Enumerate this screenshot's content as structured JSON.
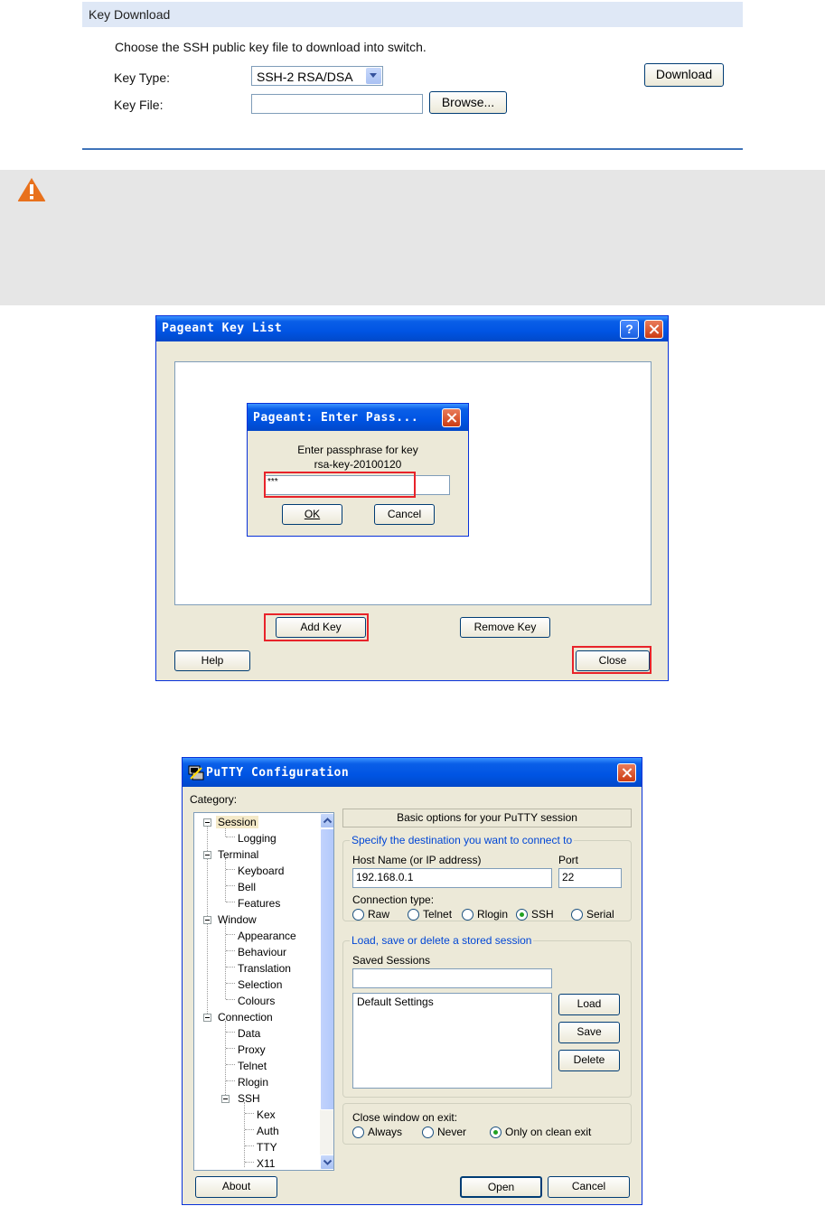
{
  "key_download": {
    "header": "Key Download",
    "instruction": "Choose the SSH public key file to download into switch.",
    "key_type_label": "Key Type:",
    "key_type_value": "SSH-2 RSA/DSA",
    "key_file_label": "Key File:",
    "key_file_value": "",
    "browse_label": "Browse...",
    "download_label": "Download"
  },
  "pageant": {
    "title": "Pageant Key List",
    "add_key_label": "Add Key",
    "remove_key_label": "Remove Key",
    "help_label": "Help",
    "close_label": "Close",
    "dialog": {
      "title": "Pageant: Enter Pass...",
      "prompt_line1": "Enter passphrase for key",
      "prompt_line2": "rsa-key-20100120",
      "passphrase_value": "***",
      "ok_label": "OK",
      "cancel_label": "Cancel"
    }
  },
  "putty": {
    "title": "PuTTY Configuration",
    "category_label": "Category:",
    "tree": [
      "Session",
      "Logging",
      "Terminal",
      "Keyboard",
      "Bell",
      "Features",
      "Window",
      "Appearance",
      "Behaviour",
      "Translation",
      "Selection",
      "Colours",
      "Connection",
      "Data",
      "Proxy",
      "Telnet",
      "Rlogin",
      "SSH",
      "Kex",
      "Auth",
      "TTY",
      "X11"
    ],
    "banner": "Basic options for your PuTTY session",
    "dest_group": "Specify the destination you want to connect to",
    "host_label": "Host Name (or IP address)",
    "host_value": "192.168.0.1",
    "port_label": "Port",
    "port_value": "22",
    "conn_type_label": "Connection type:",
    "conn_types": [
      "Raw",
      "Telnet",
      "Rlogin",
      "SSH",
      "Serial"
    ],
    "selected_conn_type": "SSH",
    "sessions_group": "Load, save or delete a stored session",
    "saved_sessions_label": "Saved Sessions",
    "saved_sessions_value": "",
    "sessions_list": [
      "Default Settings"
    ],
    "load_label": "Load",
    "save_label": "Save",
    "delete_label": "Delete",
    "close_exit_label": "Close window on exit:",
    "exit_options": [
      "Always",
      "Never",
      "Only on clean exit"
    ],
    "selected_exit_option": "Only on clean exit",
    "about_label": "About",
    "open_label": "Open",
    "cancel_label": "Cancel"
  },
  "colors": {
    "header_bg": "#dfe8f6",
    "rule": "#3f73b9",
    "warning": "#e8711c",
    "xp_title": "#0054e3",
    "highlight_box": "#e8232a"
  }
}
